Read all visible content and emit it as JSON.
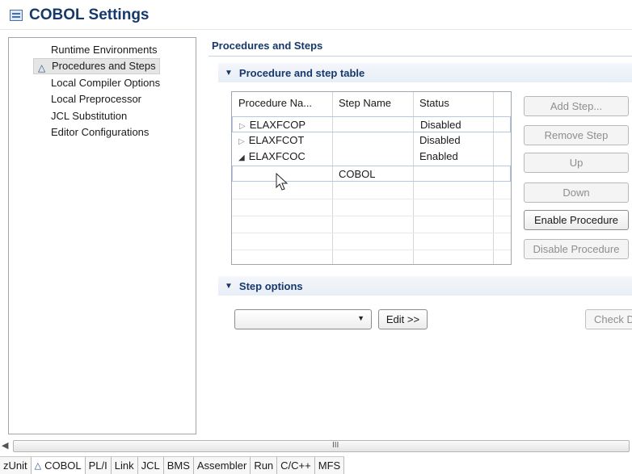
{
  "page": {
    "title": "COBOL Settings",
    "title_icon": "settings-page-icon"
  },
  "nav": {
    "items": [
      {
        "label": "Runtime Environments",
        "selected": false
      },
      {
        "label": "Procedures and Steps",
        "selected": true,
        "icon": "triangle-warning-icon",
        "icon_glyph": "△"
      },
      {
        "label": "Local Compiler Options",
        "selected": false
      },
      {
        "label": "Local Preprocessor",
        "selected": false
      },
      {
        "label": "JCL Substitution",
        "selected": false
      },
      {
        "label": "Editor Configurations",
        "selected": false
      }
    ]
  },
  "main": {
    "section_title": "Procedures and Steps",
    "procedure_table_section": {
      "title": "Procedure and step table",
      "columns": [
        "Procedure Na...",
        "Step Name",
        "Status"
      ],
      "rows": [
        {
          "procedure": "ELAXFCOP",
          "step": "",
          "status": "Disabled",
          "expander": "▷",
          "expanded": false
        },
        {
          "procedure": "ELAXFCOT",
          "step": "",
          "status": "Disabled",
          "expander": "▷",
          "expanded": false
        },
        {
          "procedure": "ELAXFCOC",
          "step": "",
          "status": "Enabled",
          "expander": "◢",
          "expanded": true
        },
        {
          "procedure": "",
          "step": "COBOL",
          "status": "",
          "expander": "",
          "expanded": false
        }
      ],
      "buttons": [
        {
          "label": "Add Step...",
          "enabled": false
        },
        {
          "label": "Remove Step",
          "enabled": false
        },
        {
          "label": "Up",
          "enabled": false
        },
        {
          "label": "Down",
          "enabled": false
        },
        {
          "label": "Enable Procedure",
          "enabled": true
        },
        {
          "label": "Disable Procedure",
          "enabled": false
        }
      ]
    },
    "step_options_section": {
      "title": "Step options",
      "combo_value": "",
      "edit_label": "Edit >>",
      "check_label": "Check D"
    }
  },
  "scrollbar": {
    "grip": "III"
  },
  "tabs": [
    {
      "label": "zUnit",
      "active": false
    },
    {
      "label": "COBOL",
      "active": true,
      "icon": "triangle-warning-icon",
      "icon_glyph": "△"
    },
    {
      "label": "PL/I",
      "active": false
    },
    {
      "label": "Link",
      "active": false
    },
    {
      "label": "JCL",
      "active": false
    },
    {
      "label": "BMS",
      "active": false
    },
    {
      "label": "Assembler",
      "active": false
    },
    {
      "label": "Run",
      "active": false
    },
    {
      "label": "C/C++",
      "active": false
    },
    {
      "label": "MFS",
      "active": false
    }
  ],
  "colors": {
    "heading": "#16386b",
    "accent_border": "#b4c8e4",
    "disabled_text": "#8e8e8e"
  }
}
